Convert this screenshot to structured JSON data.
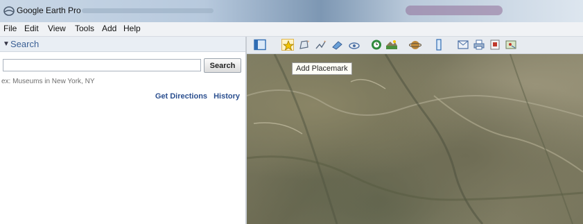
{
  "window": {
    "title": "Google Earth Pro"
  },
  "menu": [
    "File",
    "Edit",
    "View",
    "Tools",
    "Add",
    "Help"
  ],
  "search_panel": {
    "header": "Search",
    "input_value": "",
    "button_label": "Search",
    "hint": "ex: Museums in New York, NY",
    "links": [
      "Get Directions",
      "History"
    ]
  },
  "toolbar": {
    "buttons": [
      "sidebar-toggle-icon",
      "add-placemark-icon",
      "add-polygon-icon",
      "add-path-icon",
      "add-image-overlay-icon",
      "record-tour-icon",
      "historical-imagery-icon",
      "sunlight-icon",
      "switch-planet-icon",
      "ruler-icon",
      "email-icon",
      "print-icon",
      "save-image-icon",
      "view-in-maps-icon"
    ]
  },
  "tooltip": "Add Placemark",
  "colors": {
    "panel_header_text": "#3a5f94",
    "link": "#2b4f8f",
    "tooltip_bg": "#fffef6"
  }
}
